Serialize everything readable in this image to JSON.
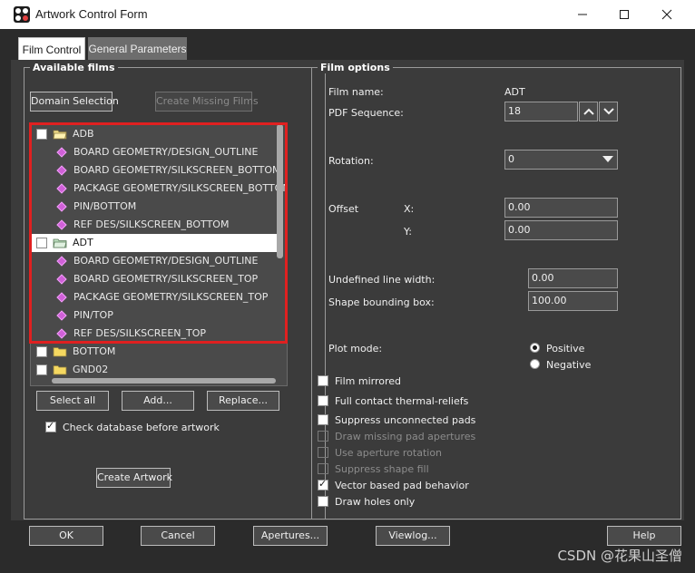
{
  "window": {
    "title": "Artwork Control Form"
  },
  "tabs": [
    {
      "label": "Film Control",
      "active": true
    },
    {
      "label": "General Parameters",
      "active": false
    }
  ],
  "available_films": {
    "group_label": "Available films",
    "domain_selection": "Domain Selection",
    "create_missing": "Create Missing Films",
    "films": [
      {
        "label": "ADB",
        "type": "folder",
        "checked": false
      },
      {
        "label": "BOARD GEOMETRY/DESIGN_OUTLINE",
        "type": "layer"
      },
      {
        "label": "BOARD GEOMETRY/SILKSCREEN_BOTTOM",
        "type": "layer"
      },
      {
        "label": "PACKAGE GEOMETRY/SILKSCREEN_BOTTOM",
        "type": "layer"
      },
      {
        "label": "PIN/BOTTOM",
        "type": "layer"
      },
      {
        "label": "REF DES/SILKSCREEN_BOTTOM",
        "type": "layer"
      },
      {
        "label": "ADT",
        "type": "folder",
        "checked": false,
        "selected": true
      },
      {
        "label": "BOARD GEOMETRY/DESIGN_OUTLINE",
        "type": "layer"
      },
      {
        "label": "BOARD GEOMETRY/SILKSCREEN_TOP",
        "type": "layer"
      },
      {
        "label": "PACKAGE GEOMETRY/SILKSCREEN_TOP",
        "type": "layer"
      },
      {
        "label": "PIN/TOP",
        "type": "layer"
      },
      {
        "label": "REF DES/SILKSCREEN_TOP",
        "type": "layer"
      },
      {
        "label": "BOTTOM",
        "type": "folder-closed",
        "checked": false
      },
      {
        "label": "GND02",
        "type": "folder-closed",
        "checked": false
      }
    ],
    "select_all": "Select all",
    "add": "Add...",
    "replace": "Replace...",
    "check_db_label": "Check database before artwork",
    "check_db_checked": true,
    "create_artwork": "Create Artwork"
  },
  "film_options": {
    "group_label": "Film options",
    "film_name_label": "Film name:",
    "film_name_value": "ADT",
    "pdf_sequence_label": "PDF Sequence:",
    "pdf_sequence_value": "18",
    "rotation_label": "Rotation:",
    "rotation_value": "0",
    "offset_label": "Offset",
    "offset_x_label": "X:",
    "offset_x_value": "0.00",
    "offset_y_label": "Y:",
    "offset_y_value": "0.00",
    "undefined_line_width_label": "Undefined line width:",
    "undefined_line_width_value": "0.00",
    "shape_bounding_box_label": "Shape bounding box:",
    "shape_bounding_box_value": "100.00",
    "plot_mode_label": "Plot mode:",
    "plot_mode_options": [
      "Positive",
      "Negative"
    ],
    "plot_mode_selected": "Positive",
    "checkboxes": [
      {
        "label": "Film mirrored",
        "checked": false,
        "enabled": true
      },
      {
        "label": "Full contact thermal-reliefs",
        "checked": false,
        "enabled": true
      },
      {
        "label": "Suppress unconnected pads",
        "checked": false,
        "enabled": true
      },
      {
        "label": "Draw missing pad apertures",
        "checked": false,
        "enabled": false
      },
      {
        "label": "Use aperture rotation",
        "checked": false,
        "enabled": false
      },
      {
        "label": "Suppress shape fill",
        "checked": false,
        "enabled": false
      },
      {
        "label": "Vector based pad behavior",
        "checked": true,
        "enabled": true
      },
      {
        "label": "Draw holes only",
        "checked": false,
        "enabled": true
      }
    ]
  },
  "footer": {
    "ok": "OK",
    "cancel": "Cancel",
    "apertures": "Apertures...",
    "viewlog": "Viewlog...",
    "help": "Help"
  },
  "watermark": "CSDN @花果山圣僧"
}
